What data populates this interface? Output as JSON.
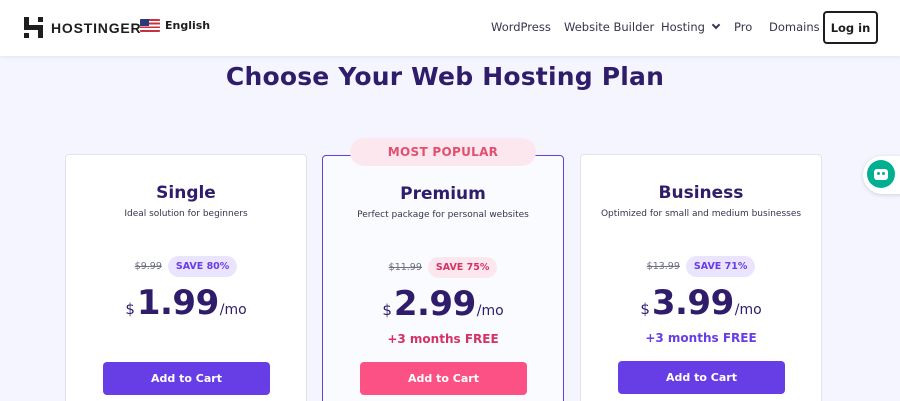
{
  "header": {
    "brand": "HOSTINGER",
    "language": "English",
    "nav": [
      "WordPress",
      "Website Builder",
      "Hosting",
      "Pro",
      "Domains"
    ],
    "login_label": "Log in"
  },
  "title": "Choose Your Web Hosting Plan",
  "badge": "MOST POPULAR",
  "plans": [
    {
      "name": "Single",
      "description": "Ideal solution for beginners",
      "old_price": "$9.99",
      "save": "SAVE 80%",
      "currency": "$",
      "price": "1.99",
      "period": "/mo",
      "bonus": "",
      "cta": "Add to Cart"
    },
    {
      "name": "Premium",
      "description": "Perfect package for personal websites",
      "old_price": "$11.99",
      "save": "SAVE 75%",
      "currency": "$",
      "price": "2.99",
      "period": "/mo",
      "bonus": "+3 months FREE",
      "cta": "Add to Cart"
    },
    {
      "name": "Business",
      "description": "Optimized for small and medium businesses",
      "old_price": "$13.99",
      "save": "SAVE 71%",
      "currency": "$",
      "price": "3.99",
      "period": "/mo",
      "bonus": "+3 months FREE",
      "cta": "Add to Cart"
    }
  ],
  "colors": {
    "primary": "#673de6",
    "accent_pink": "#fc5185",
    "heading": "#2f1c6a",
    "background": "#f4f5ff"
  },
  "icons": {
    "logo": "hostinger-logo-icon",
    "flag": "us-flag-icon",
    "dropdown": "chevron-down-icon",
    "chat": "chat-bot-icon"
  }
}
